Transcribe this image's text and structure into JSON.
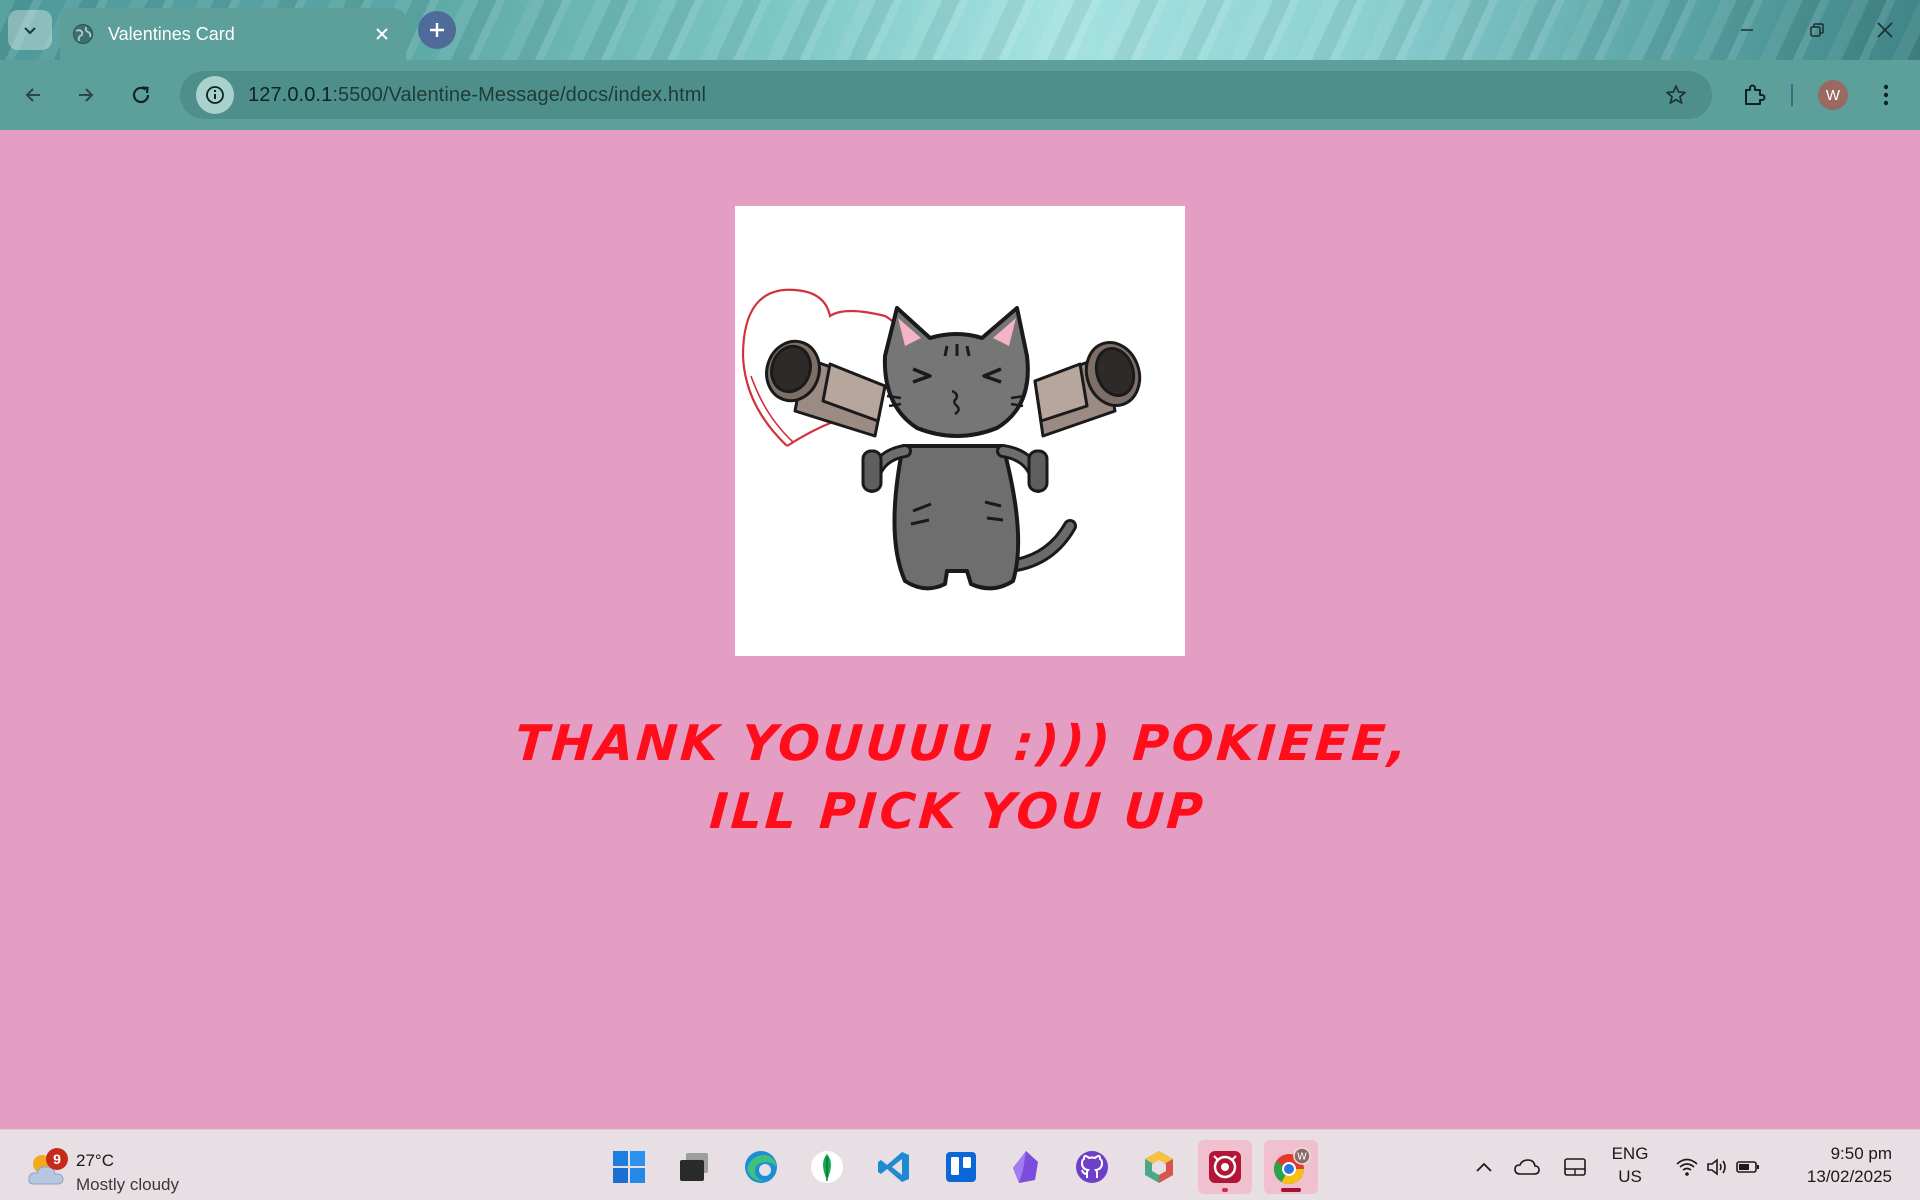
{
  "browser": {
    "tab_title": "Valentines Card",
    "url_host": "127.0.0.1",
    "url_path": ":5500/Valentine-Message/docs/index.html",
    "profile_initial": "W"
  },
  "page": {
    "message": "THANK YOUUUU :))) POKIEEE, ILL PICK YOU UP",
    "background_color": "#e49dc3",
    "text_color": "#ff0d1a"
  },
  "taskbar": {
    "weather_badge": "9",
    "temperature": "27°C",
    "condition": "Mostly cloudy",
    "apps": [
      "start-icon",
      "terminal-icon",
      "edge-icon",
      "mongodb-icon",
      "vscode-icon",
      "trello-icon",
      "obsidian-icon",
      "github-icon",
      "app-cube-icon",
      "recorder-icon",
      "chrome-icon"
    ],
    "lang_line1": "ENG",
    "lang_line2": "US",
    "time": "9:50 pm",
    "date": "13/02/2025"
  }
}
